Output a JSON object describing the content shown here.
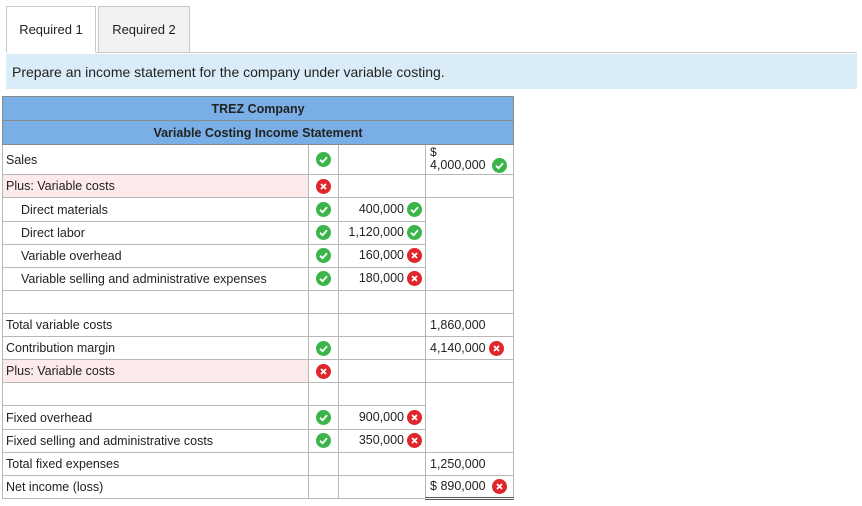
{
  "tabs": [
    {
      "label": "Required 1",
      "active": true
    },
    {
      "label": "Required 2",
      "active": false
    }
  ],
  "instruction": "Prepare an income statement for the company under variable costing.",
  "statement": {
    "company": "TREZ Company",
    "title": "Variable Costing Income Statement",
    "rows": {
      "sales": {
        "label": "Sales",
        "value": "4,000,000",
        "currency": "$"
      },
      "plus_variable_costs_1": {
        "label": "Plus: Variable costs"
      },
      "direct_materials": {
        "label": "Direct materials",
        "value": "400,000"
      },
      "direct_labor": {
        "label": "Direct labor",
        "value": "1,120,000"
      },
      "variable_overhead": {
        "label": "Variable overhead",
        "value": "160,000"
      },
      "variable_selling": {
        "label": "Variable selling and administrative expenses",
        "value": "180,000"
      },
      "total_variable": {
        "label": "Total variable costs",
        "value": "1,860,000"
      },
      "contribution_margin": {
        "label": "Contribution margin",
        "value": "4,140,000"
      },
      "plus_variable_costs_2": {
        "label": "Plus: Variable costs"
      },
      "fixed_overhead": {
        "label": "Fixed overhead",
        "value": "900,000"
      },
      "fixed_selling": {
        "label": "Fixed selling and administrative costs",
        "value": "350,000"
      },
      "total_fixed": {
        "label": "Total fixed expenses",
        "value": "1,250,000"
      },
      "net_income": {
        "label": "Net income (loss)",
        "value": "890,000",
        "currency": "$"
      }
    }
  },
  "colors": {
    "correct": "#3bb54a",
    "incorrect": "#e0252b",
    "header": "#7aaee6",
    "instruction_bg": "#d9ecf7"
  }
}
